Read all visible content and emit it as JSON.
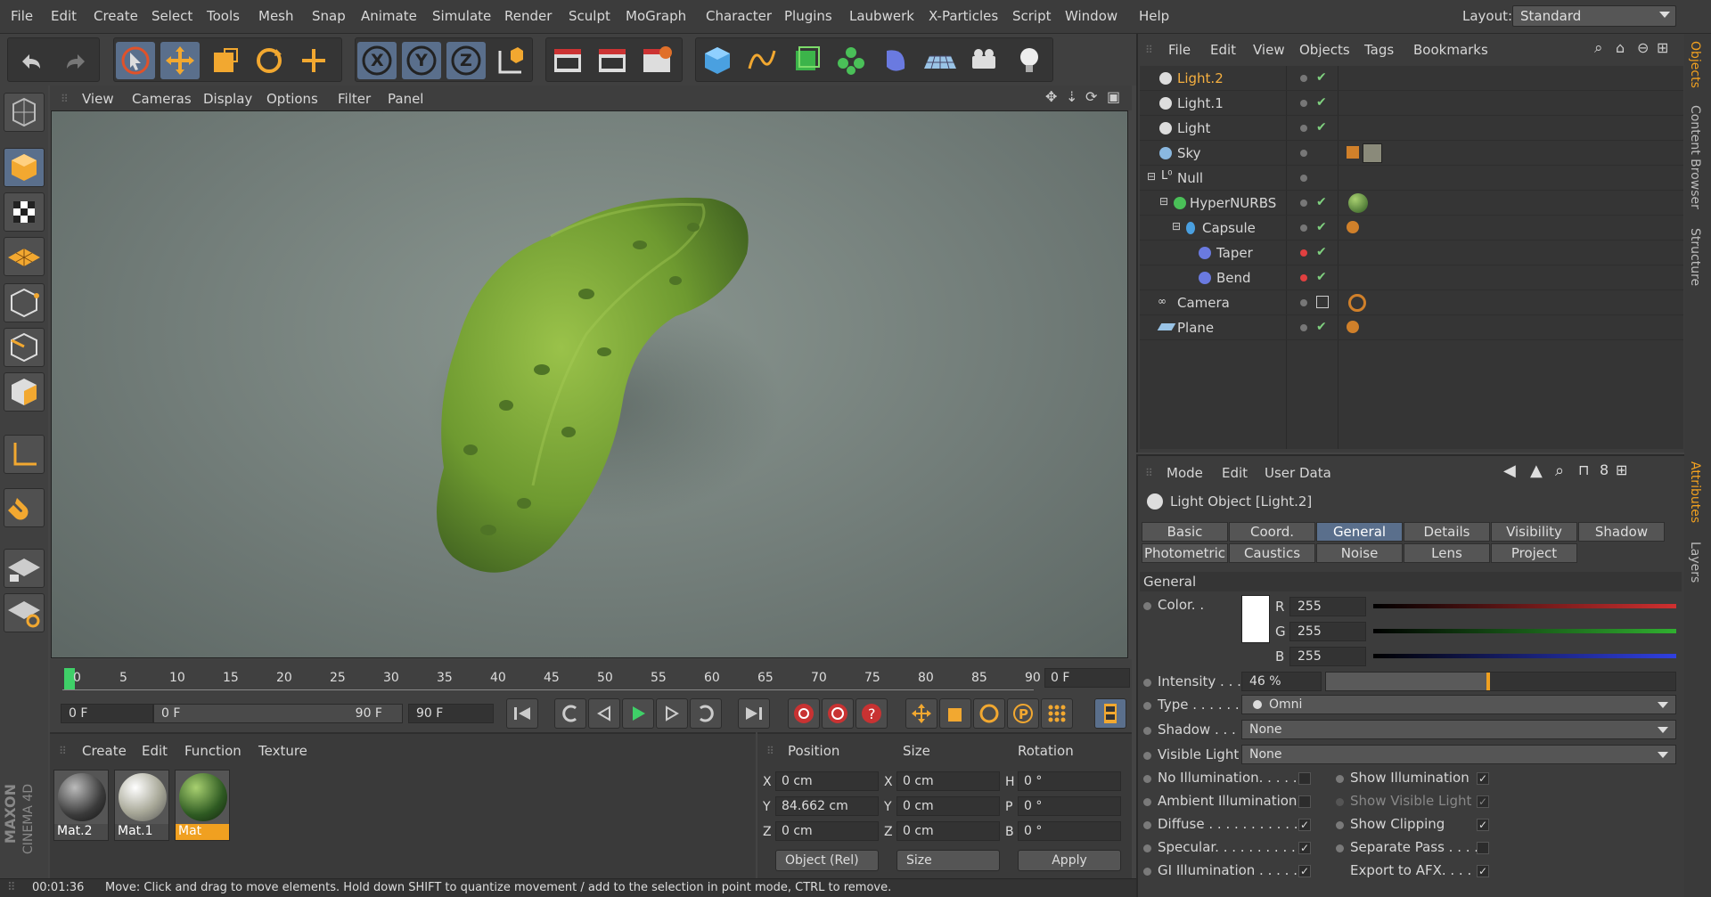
{
  "menubar": {
    "items": [
      "File",
      "Edit",
      "Create",
      "Select",
      "Tools",
      "Mesh",
      "Snap",
      "Animate",
      "Simulate",
      "Render",
      "Sculpt",
      "MoGraph",
      "Character",
      "Plugins",
      "Laubwerk",
      "X-Particles",
      "Script",
      "Window",
      "Help"
    ],
    "layout_label": "Layout:",
    "layout_value": "Standard"
  },
  "toolbar": {
    "icons": [
      "undo-icon",
      "redo-icon",
      "live-selection-icon",
      "move-icon",
      "scale-icon",
      "rotate-icon",
      "last-tool-icon",
      "x-axis-icon",
      "y-axis-icon",
      "z-axis-icon",
      "coordinate-system-icon",
      "render-view-icon",
      "render-picture-viewer-icon",
      "render-settings-icon",
      "cube-primitive-icon",
      "spline-pen-icon",
      "subdivision-surface-icon",
      "cloner-icon",
      "deformer-icon",
      "floor-icon",
      "camera-icon",
      "light-icon"
    ],
    "axis_labels": {
      "x": "X",
      "y": "Y",
      "z": "Z"
    }
  },
  "viewport": {
    "menu": [
      "View",
      "Cameras",
      "Display",
      "Options",
      "Filter",
      "Panel"
    ]
  },
  "timeline": {
    "ticks": [
      "0",
      "5",
      "10",
      "15",
      "20",
      "25",
      "30",
      "35",
      "40",
      "45",
      "50",
      "55",
      "60",
      "65",
      "70",
      "75",
      "80",
      "85",
      "90"
    ],
    "current_frame": "0 F"
  },
  "transport": {
    "start_field": "0 F",
    "range_start": "0 F",
    "range_end": "90 F",
    "end_field": "90 F"
  },
  "materials": {
    "menu": [
      "Create",
      "Edit",
      "Function",
      "Texture"
    ],
    "items": [
      {
        "name": "Mat.2",
        "color": "#3a3a3a"
      },
      {
        "name": "Mat.1",
        "color": "#8a8a7a"
      },
      {
        "name": "Mat",
        "color": "#2e5a22"
      }
    ]
  },
  "coordinates": {
    "headers": {
      "position": "Position",
      "size": "Size",
      "rotation": "Rotation"
    },
    "rows": [
      {
        "axis": "X",
        "pos": "0 cm",
        "size_axis": "X",
        "size": "0 cm",
        "rot_axis": "H",
        "rot": "0 °"
      },
      {
        "axis": "Y",
        "pos": "84.662 cm",
        "size_axis": "Y",
        "size": "0 cm",
        "rot_axis": "P",
        "rot": "0 °"
      },
      {
        "axis": "Z",
        "pos": "0 cm",
        "size_axis": "Z",
        "size": "0 cm",
        "rot_axis": "B",
        "rot": "0 °"
      }
    ],
    "mode_select": "Object (Rel)",
    "size_select": "Size",
    "apply_label": "Apply"
  },
  "status": {
    "time": "00:01:36",
    "message": "Move: Click and drag to move elements. Hold down SHIFT to quantize movement / add to the selection in point mode, CTRL to remove."
  },
  "logo": {
    "line1": "MAXON",
    "line2": "CINEMA 4D"
  },
  "objects": {
    "menu": [
      "File",
      "Edit",
      "View",
      "Objects",
      "Tags",
      "Bookmarks"
    ],
    "rows": [
      {
        "name": "Light.2",
        "icon": "light-icon",
        "selected": true,
        "indent": 0,
        "check": "✔",
        "dot_red": false
      },
      {
        "name": "Light.1",
        "icon": "light-icon",
        "selected": false,
        "indent": 0,
        "check": "✔",
        "dot_red": false
      },
      {
        "name": "Light",
        "icon": "light-icon",
        "selected": false,
        "indent": 0,
        "check": "✔",
        "dot_red": false
      },
      {
        "name": "Sky",
        "icon": "sky-icon",
        "selected": false,
        "indent": 0,
        "check": "",
        "dot_red": false
      },
      {
        "name": "Null",
        "icon": "null-icon",
        "selected": false,
        "indent": 0,
        "check": "",
        "dot_red": false
      },
      {
        "name": "HyperNURBS",
        "icon": "hypernurbs-icon",
        "selected": false,
        "indent": 1,
        "check": "✔",
        "dot_red": false
      },
      {
        "name": "Capsule",
        "icon": "capsule-icon",
        "selected": false,
        "indent": 2,
        "check": "✔",
        "dot_red": false
      },
      {
        "name": "Taper",
        "icon": "taper-icon",
        "selected": false,
        "indent": 3,
        "check": "✔",
        "dot_red": true
      },
      {
        "name": "Bend",
        "icon": "bend-icon",
        "selected": false,
        "indent": 3,
        "check": "✔",
        "dot_red": true
      },
      {
        "name": "Camera",
        "icon": "camera-icon",
        "selected": false,
        "indent": 0,
        "check": "",
        "dot_red": false
      },
      {
        "name": "Plane",
        "icon": "plane-icon",
        "selected": false,
        "indent": 0,
        "check": "✔",
        "dot_red": false
      }
    ]
  },
  "attributes": {
    "menu": [
      "Mode",
      "Edit",
      "User Data"
    ],
    "title": "Light Object [Light.2]",
    "tabs_row1": [
      "Basic",
      "Coord.",
      "General",
      "Details",
      "Visibility",
      "Shadow"
    ],
    "tabs_row2": [
      "Photometric",
      "Caustics",
      "Noise",
      "Lens",
      "Project"
    ],
    "active_tab": "General",
    "section": "General",
    "color_label": "Color. .",
    "rgb": [
      {
        "label": "R",
        "value": "255"
      },
      {
        "label": "G",
        "value": "255"
      },
      {
        "label": "B",
        "value": "255"
      }
    ],
    "intensity_label": "Intensity . . .",
    "intensity_value": "46 %",
    "intensity_fraction": 0.46,
    "type_label": "Type . . . . . . .",
    "type_value": "Omni",
    "shadow_label": "Shadow . . . . .",
    "shadow_value": "None",
    "visible_light_label": "Visible Light",
    "visible_light_value": "None",
    "left_checks": [
      {
        "label": "No Illumination. . . . .",
        "checked": false
      },
      {
        "label": "Ambient Illumination",
        "checked": false
      },
      {
        "label": "Diffuse . . . . . . . . . . .",
        "checked": true
      },
      {
        "label": "Specular. . . . . . . . . . .",
        "checked": true
      },
      {
        "label": "GI Illumination . . . . .",
        "checked": true
      }
    ],
    "right_checks": [
      {
        "label": "Show Illumination",
        "checked": true
      },
      {
        "label": "Show Visible Light",
        "checked": true
      },
      {
        "label": "Show Clipping",
        "checked": true
      },
      {
        "label": "Separate Pass . . . .",
        "checked": false
      },
      {
        "label": "Export to AFX. . . . .",
        "checked": true
      }
    ]
  },
  "side_tabs": {
    "objects": "Objects",
    "content_browser": "Content Browser",
    "structure": "Structure",
    "attributes": "Attributes",
    "layers": "Layers"
  },
  "colors": {
    "accent": "#f0a020",
    "selection": "#5a6f8c"
  }
}
